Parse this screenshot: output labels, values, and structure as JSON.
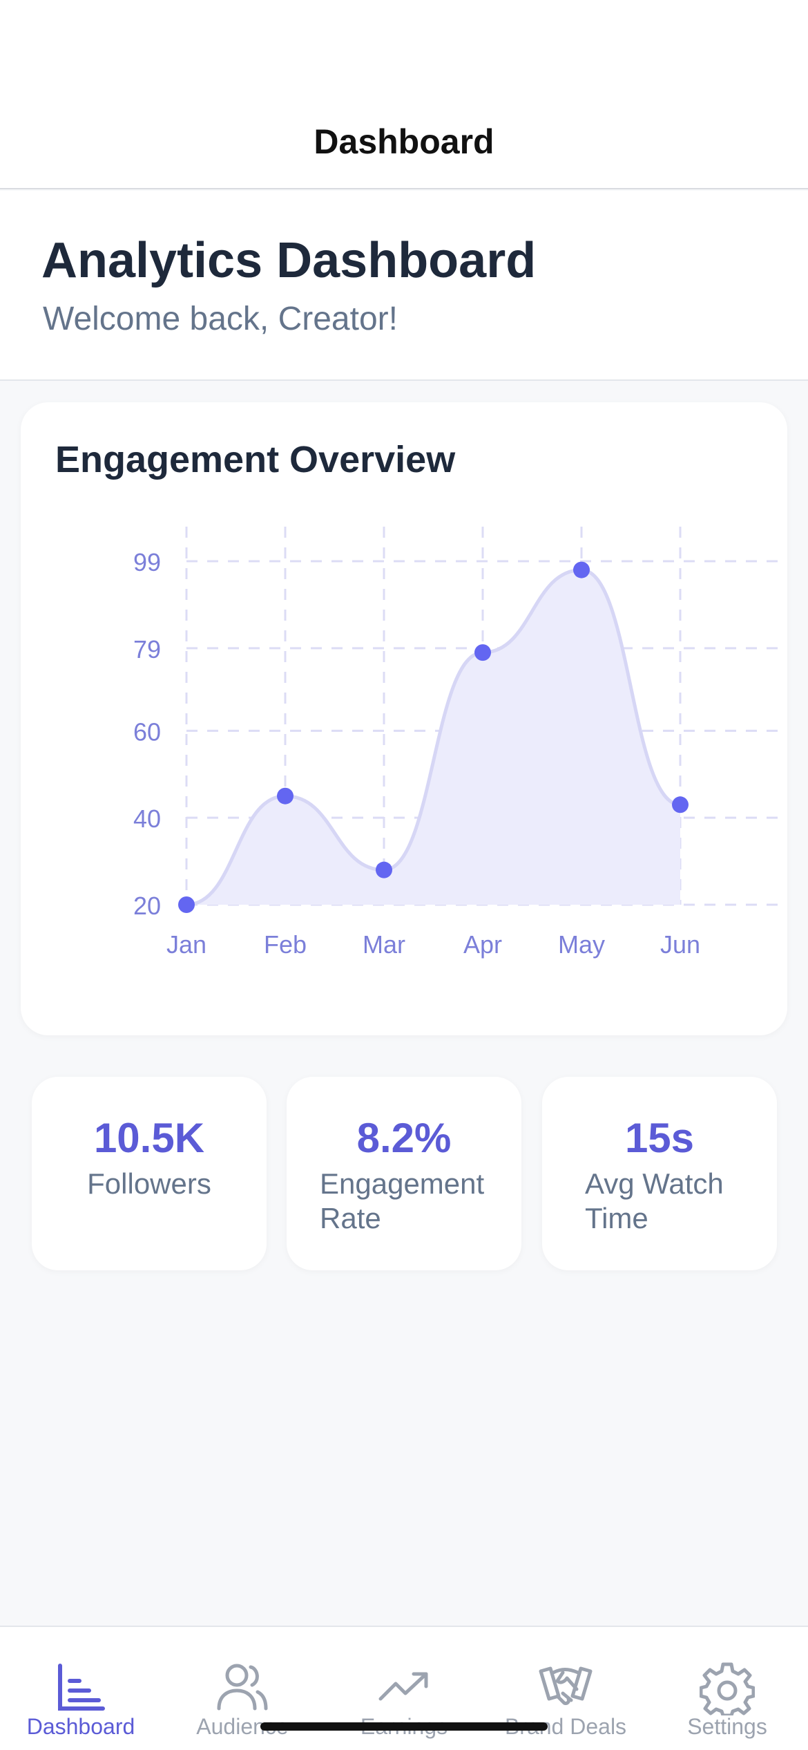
{
  "header": {
    "title": "Dashboard"
  },
  "hero": {
    "title": "Analytics Dashboard",
    "subtitle": "Welcome back, Creator!"
  },
  "chart_card": {
    "title": "Engagement Overview"
  },
  "chart_data": {
    "type": "area",
    "title": "Engagement Overview",
    "categories": [
      "Jan",
      "Feb",
      "Mar",
      "Apr",
      "May",
      "Jun"
    ],
    "values": [
      20,
      45,
      28,
      78,
      97,
      43
    ],
    "y_ticks": [
      "20",
      "40",
      "60",
      "79",
      "99"
    ],
    "ylim": [
      20,
      99
    ],
    "grid": true,
    "colors": {
      "line": "#d6d6f5",
      "fill": "#ececfc",
      "point": "#6366f1",
      "tick": "#7b7fd9",
      "grid": "#dcdcf5"
    }
  },
  "stats": [
    {
      "value": "10.5K",
      "label_lines": [
        "Followers"
      ]
    },
    {
      "value": "8.2%",
      "label_lines": [
        "Engagement",
        "Rate"
      ]
    },
    {
      "value": "15s",
      "label_lines": [
        "Avg Watch",
        "Time"
      ]
    }
  ],
  "tabs": [
    {
      "label": "Dashboard",
      "icon": "bar-chart-icon",
      "active": true
    },
    {
      "label": "Audience",
      "icon": "users-icon",
      "active": false
    },
    {
      "label": "Earnings",
      "icon": "trending-up-icon",
      "active": false
    },
    {
      "label": "Brand Deals",
      "icon": "handshake-icon",
      "active": false
    },
    {
      "label": "Settings",
      "icon": "gear-icon",
      "active": false
    }
  ],
  "colors": {
    "accent": "#5b5bd6",
    "muted": "#9ca3af"
  }
}
